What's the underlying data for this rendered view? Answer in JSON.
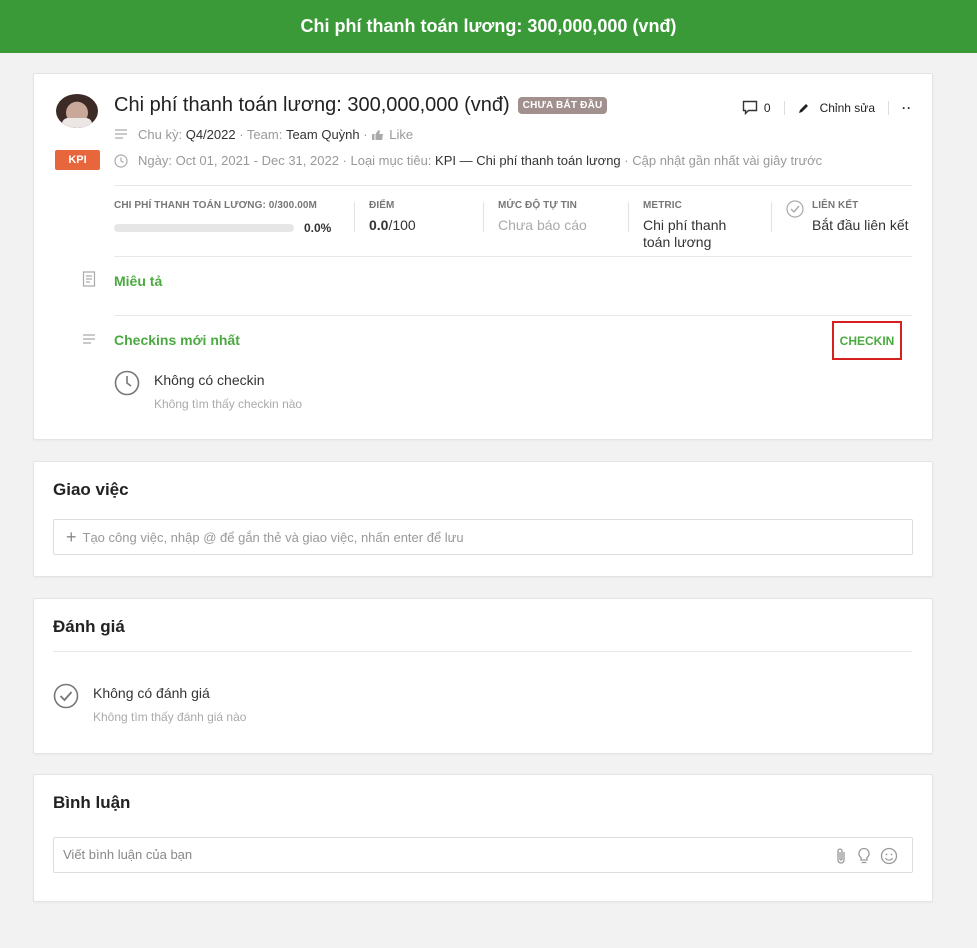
{
  "header": {
    "title": "Chi phí thanh toán lương: 300,000,000 (vnđ)"
  },
  "kpi": {
    "title": "Chi phí thanh toán lương: 300,000,000 (vnđ)",
    "status": "CHƯA BẮT ĐẦU",
    "badge": "KPI",
    "comments_count": "0",
    "edit_label": "Chỉnh sửa",
    "more_label": "··",
    "meta1": {
      "cycle_label": "Chu kỳ:",
      "cycle_value": "Q4/2022",
      "team_label": "· Team:",
      "team_value": "Team Quỳnh",
      "dot": "·",
      "like_label": "Like"
    },
    "meta2": {
      "date_label": "Ngày:",
      "date_value": "Oct 01, 2021 - Dec 31, 2022",
      "type_label": "· Loại mục tiêu:",
      "type_value": "KPI — Chi phí thanh toán lương",
      "updated": "· Cập nhật gần nhất vài giây trước"
    },
    "stats": {
      "cost_label": "CHI PHÍ THANH TOÁN LƯƠNG: 0/300.00M",
      "progress_pct": "0.0%",
      "progress_fraction": 0.0,
      "score_label": "ĐIỂM",
      "score_value": "0.0",
      "score_max": "/100",
      "confidence_label": "MỨC ĐỘ TỰ TIN",
      "confidence_value": "Chưa báo cáo",
      "metric_label": "METRIC",
      "metric_value": "Chi phí thanh toán lương",
      "link_label": "LIÊN KẾT",
      "link_value": "Bắt đầu liên kết"
    },
    "description_label": "Miêu tả",
    "checkins_label": "Checkins mới nhất",
    "checkin_button": "CHECKIN",
    "no_checkin_title": "Không có checkin",
    "no_checkin_sub": "Không tìm thấy checkin nào"
  },
  "tasks": {
    "title": "Giao việc",
    "placeholder": "Tạo công việc, nhập @ để gắn thẻ và giao việc, nhấn enter để lưu"
  },
  "review": {
    "title": "Đánh giá",
    "empty_title": "Không có đánh giá",
    "empty_sub": "Không tìm thấy đánh giá nào"
  },
  "comments": {
    "title": "Bình luận",
    "placeholder": "Viết bình luận của bạn"
  },
  "colors": {
    "green": "#3a9a37",
    "accent_green": "#4aaa3f",
    "kpi_orange": "#e8663c",
    "highlight_red": "#d61f1f"
  }
}
